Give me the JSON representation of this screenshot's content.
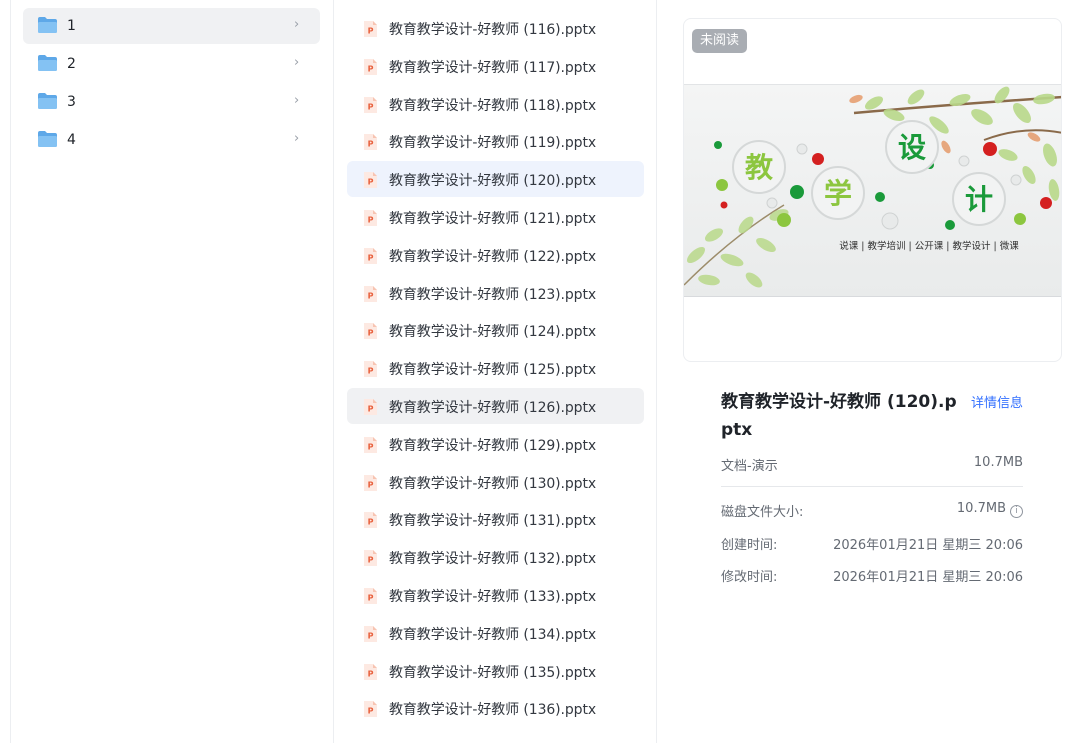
{
  "folders": [
    {
      "label": "1"
    },
    {
      "label": "2"
    },
    {
      "label": "3"
    },
    {
      "label": "4"
    }
  ],
  "files": [
    {
      "name": "教育教学设计-好教师 (116).pptx"
    },
    {
      "name": "教育教学设计-好教师 (117).pptx"
    },
    {
      "name": "教育教学设计-好教师 (118).pptx"
    },
    {
      "name": "教育教学设计-好教师 (119).pptx"
    },
    {
      "name": "教育教学设计-好教师 (120).pptx"
    },
    {
      "name": "教育教学设计-好教师 (121).pptx"
    },
    {
      "name": "教育教学设计-好教师 (122).pptx"
    },
    {
      "name": "教育教学设计-好教师 (123).pptx"
    },
    {
      "name": "教育教学设计-好教师 (124).pptx"
    },
    {
      "name": "教育教学设计-好教师 (125).pptx"
    },
    {
      "name": "教育教学设计-好教师 (126).pptx"
    },
    {
      "name": "教育教学设计-好教师 (129).pptx"
    },
    {
      "name": "教育教学设计-好教师 (130).pptx"
    },
    {
      "name": "教育教学设计-好教师 (131).pptx"
    },
    {
      "name": "教育教学设计-好教师 (132).pptx"
    },
    {
      "name": "教育教学设计-好教师 (133).pptx"
    },
    {
      "name": "教育教学设计-好教师 (134).pptx"
    },
    {
      "name": "教育教学设计-好教师 (135).pptx"
    },
    {
      "name": "教育教学设计-好教师 (136).pptx"
    }
  ],
  "preview": {
    "badge": "未阅读",
    "slide_chars": [
      "教",
      "学",
      "设",
      "计"
    ],
    "slide_subtitle": "说课 | 教学培训 | 公开课 | 教学设计 | 微课"
  },
  "details": {
    "title": "教育教学设计-好教师 (120).pptx",
    "detail_link": "详情信息",
    "type_label": "文档-演示",
    "type_size": "10.7MB",
    "disk_label": "磁盘文件大小:",
    "disk_value": "10.7MB",
    "created_label": "创建时间:",
    "created_value": "2026年01月21日 星期三 20:06",
    "modified_label": "修改时间:",
    "modified_value": "2026年01月21日 星期三 20:06"
  },
  "colors": {
    "folder": "#6fb5ee",
    "ppt": "#e8603c",
    "selected_file": "#eef3fd",
    "hover_row": "#f0f1f3",
    "link": "#3370ff",
    "badge": "#a9adb3"
  }
}
